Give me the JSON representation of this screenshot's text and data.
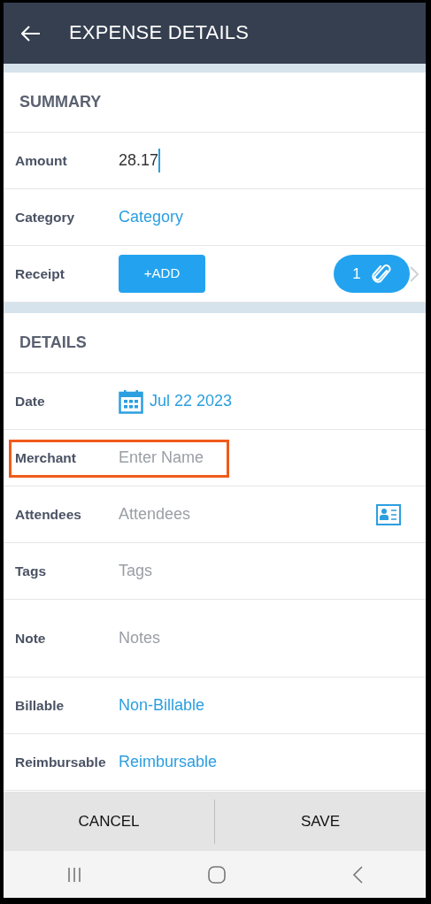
{
  "header": {
    "title": "EXPENSE DETAILS"
  },
  "sections": [
    {
      "title": "SUMMARY",
      "rows": [
        {
          "kind": "input",
          "label": "Amount",
          "value": "28.17",
          "focused": true,
          "highlighted": false
        },
        {
          "kind": "link",
          "label": "Category",
          "value": "Category",
          "highlighted": false
        },
        {
          "kind": "receipt",
          "label": "Receipt",
          "button": "+ADD",
          "count": "1",
          "highlighted": false
        }
      ]
    },
    {
      "title": "DETAILS",
      "rows": [
        {
          "kind": "date",
          "label": "Date",
          "value": "Jul 22 2023",
          "highlighted": false
        },
        {
          "kind": "placeholder",
          "label": "Merchant",
          "placeholder": "Enter Name",
          "highlighted": true
        },
        {
          "kind": "contacts",
          "label": "Attendees",
          "placeholder": "Attendees",
          "highlighted": false
        },
        {
          "kind": "placeholder",
          "label": "Tags",
          "placeholder": "Tags",
          "highlighted": false
        },
        {
          "kind": "textarea",
          "label": "Note",
          "placeholder": "Notes",
          "highlighted": false
        },
        {
          "kind": "link",
          "label": "Billable",
          "value": "Non-Billable",
          "highlighted": false
        },
        {
          "kind": "link",
          "label": "Reimbursable",
          "value": "Reimbursable",
          "highlighted": false
        }
      ]
    }
  ],
  "footer": {
    "buttons": [
      "CANCEL",
      "SAVE"
    ]
  }
}
